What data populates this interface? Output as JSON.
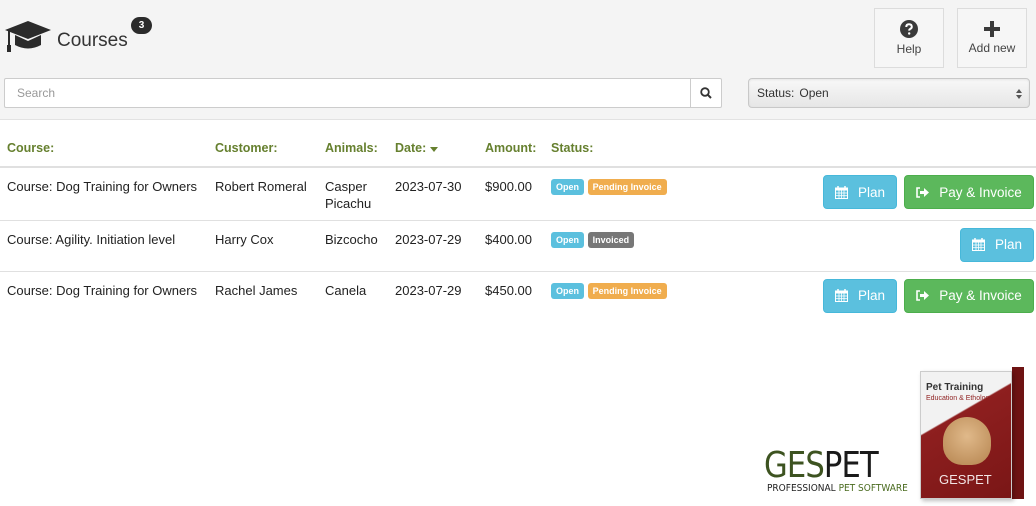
{
  "header": {
    "title": "Courses",
    "count": "3",
    "help_label": "Help",
    "add_new_label": "Add new"
  },
  "search": {
    "placeholder": "Search",
    "value": ""
  },
  "status_filter": {
    "prefix": "Status:",
    "selected": "Open"
  },
  "table": {
    "columns": [
      "Course:",
      "Customer:",
      "Animals:",
      "Date:",
      "Amount:",
      "Status:"
    ],
    "sorted_column": "Date:",
    "rows": [
      {
        "course": "Course: Dog Training for Owners",
        "customer": "Robert Romeral",
        "animals": "Casper Picachu",
        "date": "2023-07-30",
        "amount": "$900.00",
        "status": "Open",
        "invoice_status": "Pending Invoice",
        "plan_label": "Plan",
        "pay_label": "Pay & Invoice"
      },
      {
        "course": "Course: Agility. Initiation level",
        "customer": "Harry Cox",
        "animals": "Bizcocho",
        "date": "2023-07-29",
        "amount": "$400.00",
        "status": "Open",
        "invoice_status": "Invoiced",
        "plan_label": "Plan"
      },
      {
        "course": "Course: Dog Training for Owners",
        "customer": "Rachel James",
        "animals": "Canela",
        "date": "2023-07-29",
        "amount": "$450.00",
        "status": "Open",
        "invoice_status": "Pending Invoice",
        "plan_label": "Plan",
        "pay_label": "Pay & Invoice"
      }
    ]
  },
  "promo": {
    "logo_part1": "GES",
    "logo_part2": "PET",
    "tagline_part1": "PROFESSIONAL ",
    "tagline_part2": "PET SOFTWARE",
    "box_title": "Pet Training",
    "box_subtitle": "Education & Ethology",
    "box_brand": "GESPET"
  },
  "colors": {
    "header_green": "#66802f",
    "info_blue": "#5bc0de",
    "success_green": "#5cb85c",
    "warning_orange": "#f0ad4e",
    "default_gray": "#777777"
  }
}
